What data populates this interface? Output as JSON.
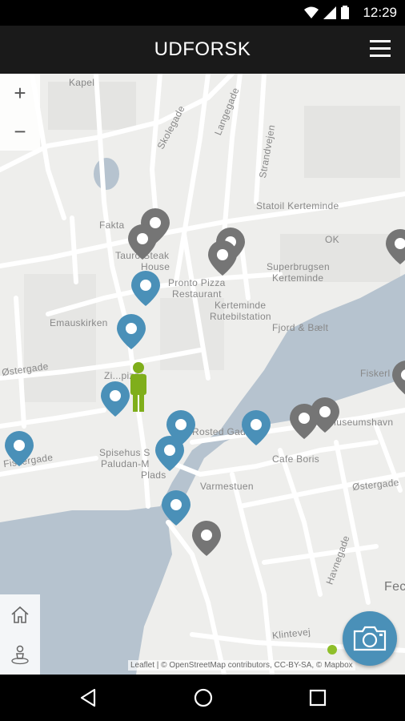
{
  "status_bar": {
    "time": "12:29"
  },
  "app_bar": {
    "title": "UDFORSK",
    "menu_icon": "hamburger-menu-icon"
  },
  "map": {
    "zoom_in_label": "+",
    "zoom_out_label": "−",
    "attribution": "Leaflet | © OpenStreetMap contributors, CC-BY-SA, © Mapbox",
    "labels": [
      "Kapel",
      "Skolegade",
      "Langegade",
      "Strandvejen",
      "Statoil Kerteminde",
      "Fakta",
      "Tauro Steak",
      "House",
      "OK",
      "Pronto Pizza",
      "Restaurant",
      "Superbrugsen",
      "Kerteminde",
      "Kerteminde",
      "Rutebilstation",
      "Fjord & Bælt",
      "Emauskirken",
      "Østergade",
      "Fiskerl",
      "Zi...pizza",
      "Rosted Gade",
      "Spisehus S",
      "Paludan-M",
      "Plads",
      "Cafe Boris",
      "Museumshavn",
      "Varmestuen",
      "Østergade",
      "Fiskergade",
      "Havnegade",
      "Klintevej",
      "Fec"
    ],
    "colors": {
      "water": "#b6c3cf",
      "land": "#eeeeec",
      "road": "#ffffff",
      "pin_blue": "#4a90b8",
      "pin_gray": "#757575",
      "person": "#7fae1b"
    }
  },
  "side_buttons": {
    "home_icon": "home-icon",
    "location_icon": "user-location-icon"
  },
  "fab": {
    "icon": "camera-icon"
  },
  "nav_bar": {
    "back": "back-icon",
    "home": "home-circle-icon",
    "recents": "recents-icon"
  }
}
